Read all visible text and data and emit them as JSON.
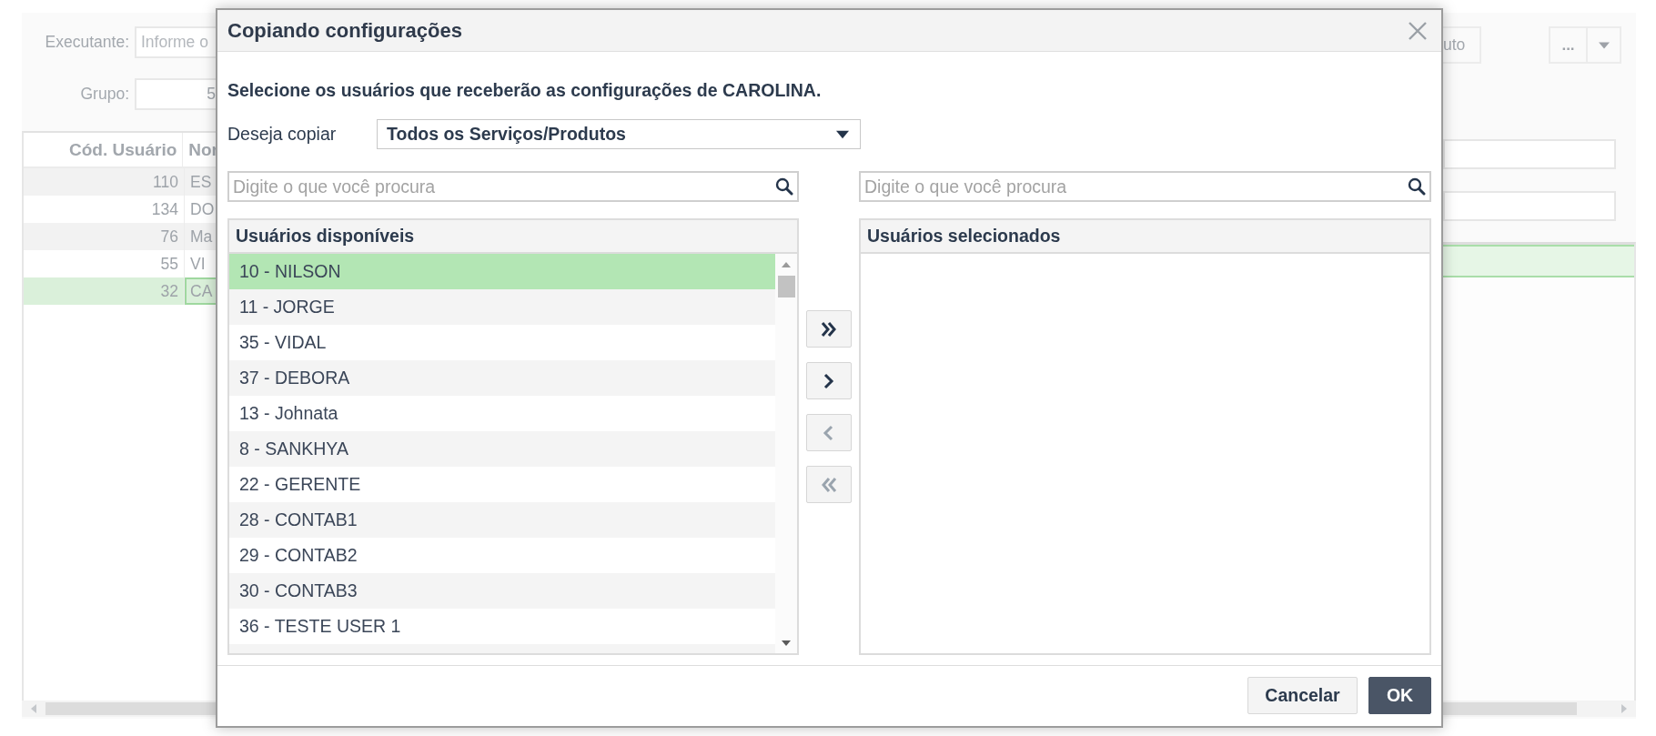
{
  "page": {
    "filters": [
      {
        "label": "Executante:",
        "placeholder": "Informe o"
      },
      {
        "label": "Grupo:",
        "value": "5"
      }
    ],
    "toolbar": {
      "button": "uto",
      "menu_button": "..."
    },
    "grid": {
      "columns": [
        "Cód. Usuário",
        "Nor"
      ],
      "rows": [
        {
          "code": "110",
          "name": "ES",
          "selected": false
        },
        {
          "code": "134",
          "name": "DO",
          "selected": false
        },
        {
          "code": "76",
          "name": "Ma",
          "selected": false
        },
        {
          "code": "55",
          "name": "VI",
          "selected": false
        },
        {
          "code": "32",
          "name": "CA",
          "selected": true
        }
      ]
    },
    "detail": {
      "rows": [
        {
          "selected": true
        }
      ]
    }
  },
  "dialog": {
    "title": "Copiando configurações",
    "instruction": "Selecione os usuários que receberão as configurações de CAROLINA.",
    "copy": {
      "label": "Deseja copiar",
      "value": "Todos os Serviços/Produtos"
    },
    "available_users": {
      "search_placeholder": "Digite o que você procura",
      "title": "Usuários disponíveis",
      "items": [
        {
          "label": "10 - NILSON",
          "selected": true
        },
        {
          "label": "11 - JORGE",
          "selected": false
        },
        {
          "label": "35 - VIDAL",
          "selected": false
        },
        {
          "label": "37 - DEBORA",
          "selected": false
        },
        {
          "label": "13 - Johnata",
          "selected": false
        },
        {
          "label": "8 - SANKHYA",
          "selected": false
        },
        {
          "label": "22 - GERENTE",
          "selected": false
        },
        {
          "label": "28 - CONTAB1",
          "selected": false
        },
        {
          "label": "29 - CONTAB2",
          "selected": false
        },
        {
          "label": "30 - CONTAB3",
          "selected": false
        },
        {
          "label": "36 - TESTE USER 1",
          "selected": false
        }
      ]
    },
    "transfer_buttons": [
      {
        "kind": "add_all",
        "disabled": false
      },
      {
        "kind": "add",
        "disabled": false
      },
      {
        "kind": "remove",
        "disabled": true
      },
      {
        "kind": "remove_all",
        "disabled": true
      }
    ],
    "selected_users": {
      "search_placeholder": "Digite o que você procura",
      "title": "Usuários selecionados"
    },
    "buttons": [
      {
        "label": "Cancelar",
        "kind": "secondary"
      },
      {
        "label": "OK",
        "kind": "primary"
      }
    ]
  }
}
